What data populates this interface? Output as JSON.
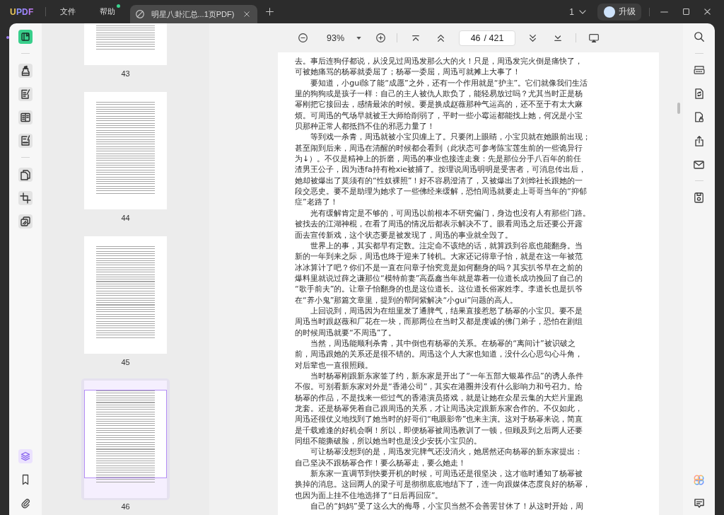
{
  "title_bar": {
    "logo": "UPDF",
    "menus": [
      {
        "label": "文件",
        "badge": false
      },
      {
        "label": "帮助",
        "badge": true
      }
    ],
    "tabs": [
      {
        "title": "明星八卦汇总...1页PDF)",
        "selected": true
      }
    ],
    "count_menu": {
      "label": "1"
    },
    "upgrade_button": {
      "label": "升级"
    }
  },
  "left_toolbar": {
    "modes": [
      {
        "selected": true
      },
      {
        "selected": false
      },
      {
        "selected": false
      },
      {
        "selected": false
      },
      {
        "selected": false
      },
      {
        "selected": false
      },
      {
        "selected": false
      },
      {
        "selected": false
      }
    ],
    "panels": [
      {
        "selected": true
      },
      {
        "selected": false
      },
      {
        "selected": false
      }
    ]
  },
  "thumbnails": [
    {
      "label": "43",
      "selected": false
    },
    {
      "label": "44",
      "selected": false
    },
    {
      "label": "45",
      "selected": false
    },
    {
      "label": "46",
      "selected": true
    }
  ],
  "doc_toolbar": {
    "zoom": "93%",
    "page_field": {
      "value": "46",
      "total": "/ 421"
    }
  },
  "page": {
    "paragraphs": [
      {
        "indented": false,
        "lines": [
          "去。事后连狗仔都说，从没见过周迅发那么大的火！只是，周迅发完火倒是痛快了，",
          "可被她痛骂的杨幂就委屈了；杨幂一委屈，周迅可就摊上大事了！"
        ]
      },
      {
        "indented": true,
        "lines": [
          "要知道，小gui除了能“成愿”之外，还有一个作用就是“护主”。它们就像我们生活",
          "里的狗狗或是孩子一样：自己的主人被仇人欺负了，能轻易放过吗？尤其当时正是杨",
          "幂刚把它接回去，感情最浓的时候。要是换成赵薇那种气运高的，还不至于有太大麻",
          "烦。可周迅的气场早就被王大师给削弱了，平时一些小霉运都能找上她，何况是小宝",
          "贝那种正常人都抵挡不住的邪恶力量了！"
        ]
      },
      {
        "indented": true,
        "lines": [
          "等到戏一杀青，周迅就被小宝贝缠上了。只要闭上眼睛，小宝贝就在她眼前出现；",
          "甚至闹到后来，周迅在清醒的时候都会看到（此状态可参考陈宝莲生前的一些诡异行",
          "为↓）。不仅是精神上的折磨，周迅的事业也接连走衰：先是那位分手八百年的前任",
          "渣男王公子，因为违fa持有枪xie被捕了。按理说周迅明明是受害者，可消息传出后，",
          "她却被爆出了莫须有的“性奴裸照”！好不容易澄清了，又被爆出了刘烨社长跟她的一",
          "段交恶史。要不是助理为她求了一些佛经来缓解，恐怕周迅就要走上哥哥当年的“抑郁",
          "症”老路了！"
        ]
      },
      {
        "indented": true,
        "lines": [
          "光有缓解肯定是不够的，可周迅以前根本不研究偏门，身边也没有人有那些门路。",
          "被找去的江湖神棍，在看了周迅的情况后都表示解决不了。眼看周迅之后还要公开露",
          "面去宣传新戏，这个状态要是被发现了，周迅的事业就全毁了。"
        ]
      },
      {
        "indented": true,
        "lines": [
          "世界上的事，其实都早有定数。注定命不该绝的话，就算跌到谷底也能翻身。当",
          "新的一年到来之际，周迅也终于迎来了转机。大家还记得章子怡，就是在这一年被范",
          "冰冰算计了吧？你们不是一直在问章子怡究竟是如何翻身的吗？其实扒爷早在之前的",
          "爆料里就说过薛之谦那位“模特前妻”高磊鑫当年就是靠着一位道长成功挽回了自己的",
          "“歌手前夫”的。让章子怡翻身的也是这位道长。这位道长俗家姓李。李道长也是扒爷",
          "在“养小鬼”那篇文章里，提到的帮阿紫解决“小gui”问题的高人。"
        ]
      },
      {
        "indented": true,
        "lines": [
          "上回说到，周迅因为在组里发了通脾气，结果直接惹怒了杨幂的小宝贝。要不是",
          "周迅当时跟赵薇和厂花在一块，而那两位在当时又都是虔诚的佛门弟子，恐怕在剧组",
          "的时候周迅就要“不周迅”了。"
        ]
      },
      {
        "indented": true,
        "lines": [
          "当然，周迅能顺利杀青，其中倒也有杨幂的关系。在杨幂的“离间计”被识破之",
          "前，周迅跟她的关系还是很不错的。周迅这个人大家也知道，没什么心思勾心斗角，",
          "对后辈也一直很照顾。"
        ]
      },
      {
        "indented": true,
        "lines": [
          "当时杨幂刚跟新东家签了约，新东家是开出了“一年五部大银幕作品”的诱人条件",
          "不假。可别看新东家对外是“香港公司”，其实在港圈并没有什么影响力和号召力。给",
          "杨幂的作品，不是找来一些过气的香港演员搭戏，就是让她在众星云集的大烂片里跑",
          "龙套。还是杨幂凭着自己跟周迅的关系，才让周迅决定跟新东家合作的。不仅如此，",
          "周迅还很仗义地找到了她当时的好哥们“电眼影帝”也来主演。这对于杨幂来说，简直",
          "是千载难逢的好机会啊！所以，即便杨幂被周迅教训了一顿，但顾及到之后两人还要",
          "同组不能撕破脸，所以她当时也是没少安抚小宝贝的。"
        ]
      },
      {
        "indented": true,
        "lines": [
          "可让杨幂没想到的是，周迅发完脾气还没消火，她居然还向杨幂的新东家提出：",
          "自己坚决不跟杨幂合作！要么杨幂走，要么她走！"
        ]
      },
      {
        "indented": true,
        "lines": [
          "新东家一直调节到快要开机的时候，可周迅还是很坚决，这才临时通知了杨幂被",
          "换掉的消息。这回两人的梁子可是彻彻底底地结下了，连一向跟媒体态度良好的杨幂，",
          "也因为面上挂不住地选择了“日后再回应”。"
        ]
      },
      {
        "indented": true,
        "lines": [
          "自己的“妈妈”受了这么大的侮辱，小宝贝当然不会善罢甘休了！从这时开始，周"
        ]
      }
    ]
  }
}
